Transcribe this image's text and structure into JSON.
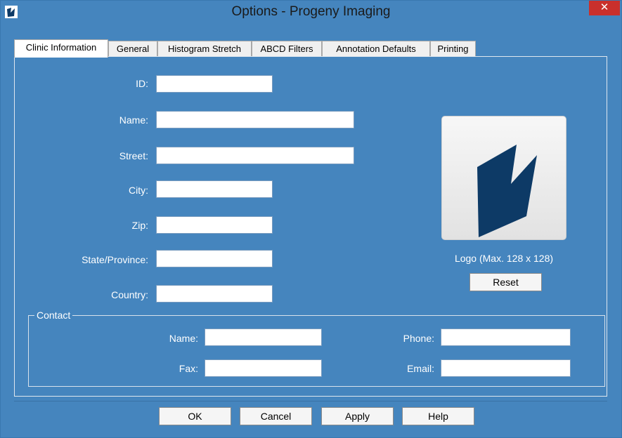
{
  "window": {
    "title": "Options - Progeny Imaging",
    "close_glyph": "✕"
  },
  "tabs": [
    {
      "label": "Clinic Information",
      "active": true
    },
    {
      "label": "General"
    },
    {
      "label": "Histogram Stretch"
    },
    {
      "label": "ABCD Filters"
    },
    {
      "label": "Annotation Defaults"
    },
    {
      "label": "Printing"
    }
  ],
  "clinic": {
    "id_label": "ID:",
    "name_label": "Name:",
    "street_label": "Street:",
    "city_label": "City:",
    "zip_label": "Zip:",
    "state_label": "State/Province:",
    "country_label": "Country:",
    "id_value": "",
    "name_value": "",
    "street_value": "",
    "city_value": "",
    "zip_value": "",
    "state_value": "",
    "country_value": ""
  },
  "logo": {
    "icon": "progeny-logo-icon",
    "caption": "Logo (Max. 128 x 128)",
    "reset_label": "Reset",
    "color": "#0d3a66"
  },
  "contact": {
    "legend": "Contact",
    "name_label": "Name:",
    "fax_label": "Fax:",
    "phone_label": "Phone:",
    "email_label": "Email:",
    "name_value": "",
    "fax_value": "",
    "phone_value": "",
    "email_value": ""
  },
  "buttons": {
    "ok": "OK",
    "cancel": "Cancel",
    "apply": "Apply",
    "help": "Help"
  },
  "colors": {
    "window_bg": "#4585be",
    "close_button": "#c9302c"
  }
}
